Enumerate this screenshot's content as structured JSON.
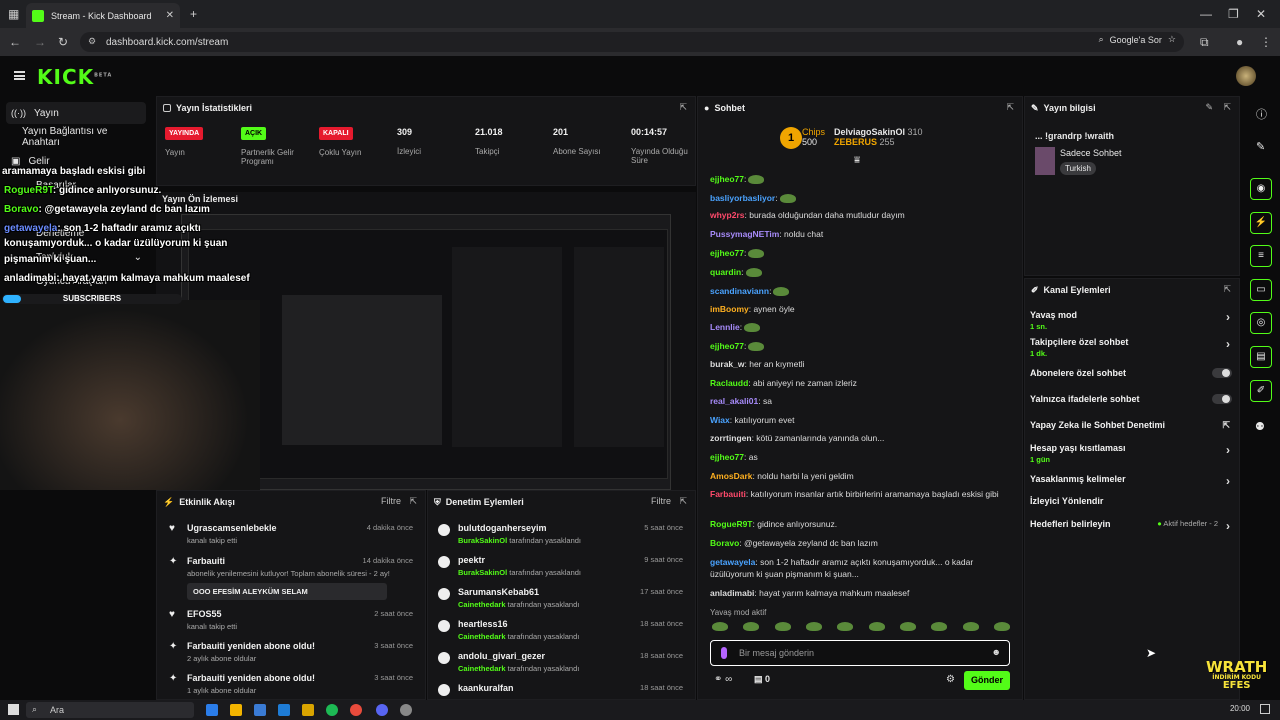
{
  "browser": {
    "tab_title": "Stream - Kick Dashboard",
    "url": "dashboard.kick.com/stream",
    "google_search": "Google'a Sor"
  },
  "app": {
    "logo": "KICK",
    "logo_sup": "BETA"
  },
  "left_nav": {
    "items": [
      {
        "label": "Yayın"
      },
      {
        "label": "Yayın Bağlantısı ve Anahtarı"
      },
      {
        "label": "Gelir"
      },
      {
        "label": "Başarılar"
      },
      {
        "label": "Denetleme"
      },
      {
        "label": "Topluluk"
      },
      {
        "label": "Oyuncu Araçları"
      }
    ]
  },
  "stats": {
    "title": "Yayın İstatistikleri",
    "items": [
      {
        "badge": "YAYINDA",
        "label": "Yayın",
        "kind": "red"
      },
      {
        "badge": "AÇIK",
        "label": "Partnerlik Gelir Programı",
        "kind": "green"
      },
      {
        "badge": "KAPALI",
        "label": "Çoklu Yayın",
        "kind": "red"
      },
      {
        "value": "309",
        "label": "İzleyici"
      },
      {
        "value": "21.018",
        "label": "Takipçi"
      },
      {
        "value": "201",
        "label": "Abone Sayısı"
      },
      {
        "value": "00:14:57",
        "label": "Yayında Olduğu Süre"
      }
    ]
  },
  "preview": {
    "title": "Yayın Ön İzlemesi",
    "overlay_lines": [
      {
        "user": "",
        "text": "aramamaya başladı eskisi gibi"
      },
      {
        "user": "RogueR9T",
        "text": ": gidince anlıyorsunuz."
      },
      {
        "user": "Boravo",
        "text": ": @getawayela zeyland dc ban lazım"
      },
      {
        "user": "getawayela",
        "text": ": son 1-2 haftadır aramız açıktı"
      },
      {
        "user": "",
        "text": "konuşamıyorduk... o kadar üzülüyorum ki şuan"
      },
      {
        "user": "",
        "text": "pişmanım ki şuan..."
      },
      {
        "user": "anladimabi",
        "text": ": hayat yarım kalmaya mahkum maalesef"
      }
    ],
    "subscribers_label": "SUBSCRIBERS"
  },
  "activity": {
    "title": "Etkinlik Akışı",
    "filter": "Filtre",
    "items": [
      {
        "icon": "heart",
        "name": "Ugrascamsenlebekle",
        "sub": "kanalı takip etti",
        "time": "4 dakika önce"
      },
      {
        "icon": "star",
        "name": "Farbauiti",
        "sub": "abonelik yenilemesini kutluyor! Toplam abonelik süresi - 2 ay!",
        "time": "14 dakika önce",
        "message": "OOO EFESİM ALEYKÜM SELAM"
      },
      {
        "icon": "heart",
        "name": "EFOS55",
        "sub": "kanalı takip etti",
        "time": "2 saat önce"
      },
      {
        "icon": "star",
        "name": "Farbauiti yeniden abone oldu!",
        "sub": "2 aylık abone oldular",
        "time": "3 saat önce"
      },
      {
        "icon": "star",
        "name": "Farbauiti yeniden abone oldu!",
        "sub": "1 aylık abone oldular",
        "time": "3 saat önce"
      }
    ]
  },
  "moderation": {
    "title": "Denetim Eylemleri",
    "filter": "Filtre",
    "suffix": "tarafından yasaklandı",
    "items": [
      {
        "name": "bulutdoganherseyim",
        "by": "BurakSakinOl",
        "time": "5 saat önce"
      },
      {
        "name": "peektr",
        "by": "BurakSakinOl",
        "time": "9 saat önce"
      },
      {
        "name": "SarumansKebab61",
        "by": "Cainethedark",
        "time": "17 saat önce"
      },
      {
        "name": "heartless16",
        "by": "Cainethedark",
        "time": "18 saat önce"
      },
      {
        "name": "andolu_givari_gezer",
        "by": "Cainethedark",
        "time": "18 saat önce"
      },
      {
        "name": "kaankuralfan",
        "by": "",
        "time": "18 saat önce"
      }
    ]
  },
  "chat": {
    "title": "Sohbet",
    "leaderboard": [
      {
        "name": "Chips",
        "value": "500"
      },
      {
        "name": "DelviagoSakinOl",
        "value": "310"
      },
      {
        "name": "ZEBERUS",
        "value": "255"
      }
    ],
    "messages": [
      {
        "user": "ejjheo77",
        "color": "#53fc18",
        "text": "",
        "emote": true
      },
      {
        "user": "basliyorbasliyor",
        "color": "#4aa3ff",
        "text": "",
        "emote": true
      },
      {
        "user": "whyp2rs",
        "color": "#ff4a6b",
        "text": ": burada olduğundan daha mutludur dayım"
      },
      {
        "user": "PussymagNETim",
        "color": "#a78bfa",
        "text": ": noldu chat"
      },
      {
        "user": "ejjheo77",
        "color": "#53fc18",
        "text": "",
        "emote": true
      },
      {
        "user": "quardin",
        "color": "#53fc18",
        "text": "",
        "emote": true
      },
      {
        "user": "scandinaviann",
        "color": "#4aa3ff",
        "text": "",
        "emote": true
      },
      {
        "user": "imBoomy",
        "color": "#ffb020",
        "text": ": aynen öyle"
      },
      {
        "user": "Lennlie",
        "color": "#a78bfa",
        "text": "",
        "emote": true
      },
      {
        "user": "ejjheo77",
        "color": "#53fc18",
        "text": "",
        "emote": true
      },
      {
        "user": "burak_w",
        "color": "#dddddd",
        "text": ": her an kıymetli"
      },
      {
        "user": "Raclaudd",
        "color": "#53fc18",
        "text": ": abi aniyeyi ne zaman izleriz"
      },
      {
        "user": "real_akali01",
        "color": "#a78bfa",
        "text": ": sa"
      },
      {
        "user": "Wiax",
        "color": "#4aa3ff",
        "text": ": katılıyorum evet"
      },
      {
        "user": "zorrtingen",
        "color": "#dddddd",
        "text": ": kötü zamanlarında yanında olun..."
      },
      {
        "user": "ejjheo77",
        "color": "#53fc18",
        "text": ": as"
      },
      {
        "user": "AmosDark",
        "color": "#ffb020",
        "text": ": noldu harbi la yeni geldim"
      },
      {
        "user": "Farbauiti",
        "color": "#ff4a6b",
        "text": ": katılıyorum insanlar artık birbirlerini aramamaya başladı eskisi gibi"
      },
      {
        "user": "RogueR9T",
        "color": "#53fc18",
        "text": ": gidince anlıyorsunuz."
      },
      {
        "user": "Boravo",
        "color": "#53fc18",
        "text": ": @getawayela zeyland dc ban lazım"
      },
      {
        "user": "getawayela",
        "color": "#4aa3ff",
        "text": ": son 1-2 haftadır aramız açıktı konuşamıyorduk... o kadar üzülüyorum ki şuan pişmanım ki şuan..."
      },
      {
        "user": "anladimabi",
        "color": "#dddddd",
        "text": ": hayat yarım kalmaya mahkum maalesef"
      }
    ],
    "slow_mode_note": "Yavaş mod aktif",
    "input_placeholder": "Bir mesaj gönderin",
    "points": "0",
    "send_label": "Gönder"
  },
  "stream_info": {
    "title": "Yayın bilgisi",
    "stream_title": "... !grandrp !wraith",
    "category": "Sadece Sohbet",
    "language": "Turkish"
  },
  "channel_actions": {
    "title": "Kanal Eylemleri",
    "items": [
      {
        "label": "Yavaş mod",
        "sub": "1 sn.",
        "control": "chevron"
      },
      {
        "label": "Takipçilere özel sohbet",
        "sub": "1 dk.",
        "control": "chevron"
      },
      {
        "label": "Abonelere özel sohbet",
        "sub": "",
        "control": "toggle"
      },
      {
        "label": "Yalnızca ifadelerle sohbet",
        "sub": "",
        "control": "toggle"
      },
      {
        "label": "Yapay Zeka ile Sohbet Denetimi",
        "sub": "",
        "control": "external"
      },
      {
        "label": "Hesap yaşı kısıtlaması",
        "sub": "1 gün",
        "control": "chevron"
      },
      {
        "label": "Yasaklanmış kelimeler",
        "sub": "",
        "control": "chevron"
      },
      {
        "label": "İzleyici Yönlendir",
        "sub": "",
        "control": "none"
      },
      {
        "label": "Hedefleri belirleyin",
        "sub": "",
        "control": "chevron",
        "extra": "Aktif hedefler - 2"
      }
    ]
  },
  "watermark": {
    "line1": "WRATH",
    "line2": "İNDİRİM KODU",
    "line3": "EFES"
  },
  "taskbar": {
    "search": "Ara",
    "time": "20:00"
  },
  "colors": {
    "accent": "#53fc18",
    "live": "#e61a2e",
    "bg": "#0b0b0c",
    "panel": "#151517"
  }
}
